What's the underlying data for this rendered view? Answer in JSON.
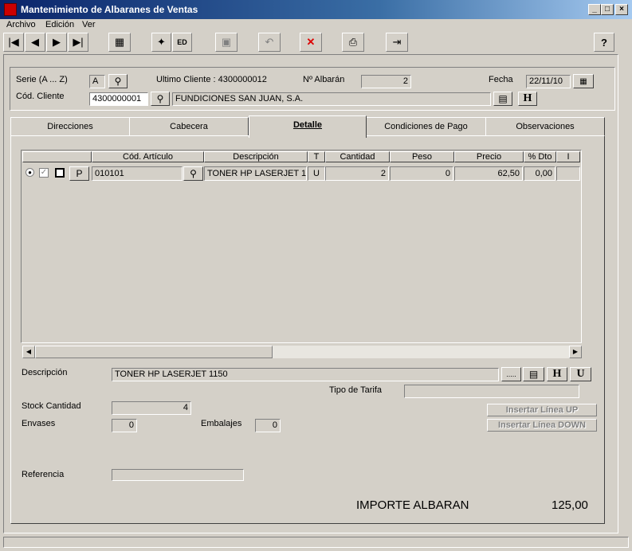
{
  "window": {
    "title": "Mantenimiento de Albaranes de Ventas",
    "minimize": "_",
    "maximize": "□",
    "close": "×"
  },
  "menu": [
    {
      "label": "Archivo"
    },
    {
      "label": "Edición"
    },
    {
      "label": "Ver"
    }
  ],
  "toolbar": {
    "first": "|◀",
    "prev": "◀",
    "next": "▶",
    "last": "▶|",
    "table": "▦",
    "new": "✦",
    "edit": "ED",
    "save": "▣",
    "undo": "↶",
    "delete": "✕",
    "print": "⎙",
    "exit": "⇥",
    "help": "?"
  },
  "header": {
    "serie_label": "Serie (A ... Z)",
    "serie_value": "A",
    "ultimo_cliente_label": "Ultimo Cliente : 4300000012",
    "albaran_label": "Nº Albarán",
    "albaran_value": "2",
    "fecha_label": "Fecha",
    "fecha_value": "22/11/10",
    "cliente_label": "Cód. Cliente",
    "cliente_code": "4300000001",
    "cliente_name": "FUNDICIONES SAN JUAN, S.A.",
    "h_button": "H"
  },
  "tabs": [
    {
      "label": "Direcciones"
    },
    {
      "label": "Cabecera"
    },
    {
      "label": "Detalle"
    },
    {
      "label": "Condiciones de Pago"
    },
    {
      "label": "Observaciones"
    }
  ],
  "grid": {
    "columns": [
      "Cód. Artículo",
      "Descripción",
      "T",
      "Cantidad",
      "Peso",
      "Precio",
      "% Dto",
      "I"
    ],
    "rows": [
      {
        "p_label": "P",
        "code": "010101",
        "desc": "TONER HP LASERJET 1",
        "t": "U",
        "cantidad": "2",
        "peso": "0",
        "precio": "62,50",
        "dto": "0,00"
      }
    ]
  },
  "detail": {
    "descripcion_label": "Descripción",
    "descripcion_value": "TONER HP LASERJET 1150",
    "dots_button": ".....",
    "h_button": "H",
    "u_button": "U",
    "tipo_tarifa_label": "Tipo de Tarifa",
    "tipo_tarifa_value": "",
    "stock_label": "Stock Cantidad",
    "stock_value": "4",
    "envases_label": "Envases",
    "envases_value": "0",
    "embalajes_label": "Embalajes",
    "embalajes_value": "0",
    "insert_up": "Insertar Línea UP",
    "insert_down": "Insertar Línea DOWN",
    "referencia_label": "Referencia",
    "referencia_value": "",
    "importe_label": "IMPORTE ALBARAN",
    "importe_value": "125,00"
  }
}
